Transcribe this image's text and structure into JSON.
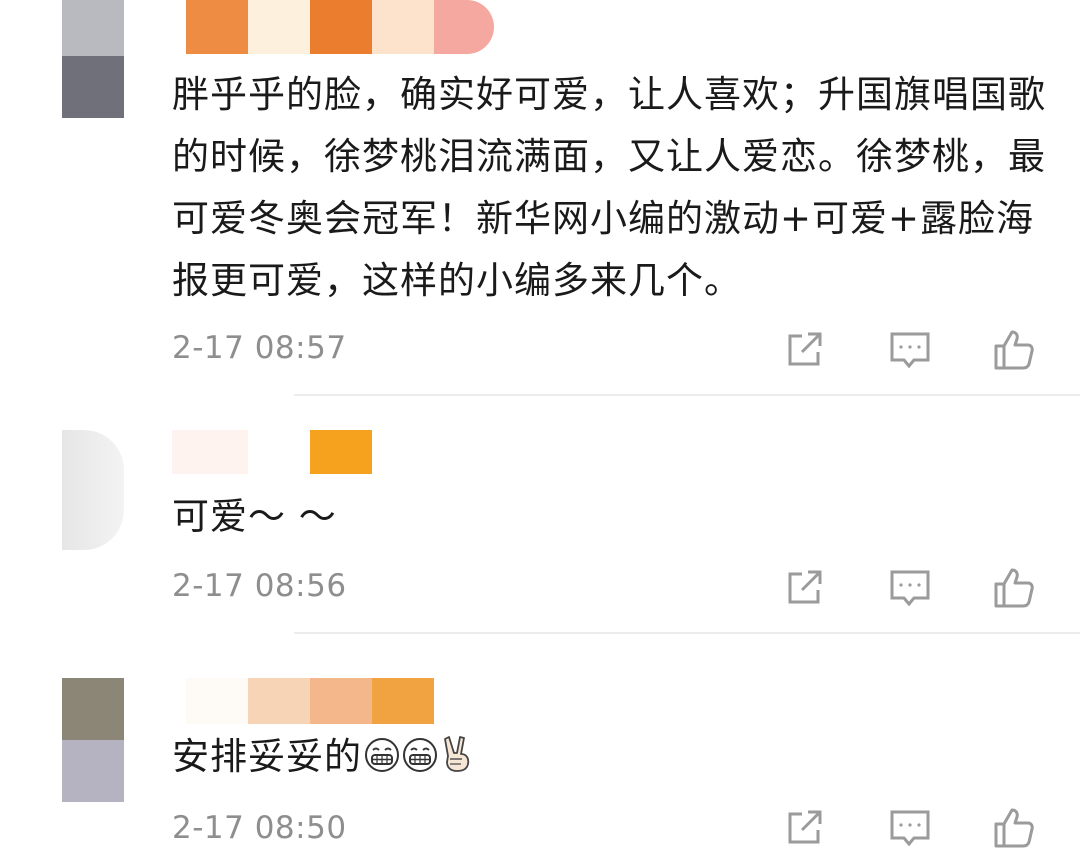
{
  "comments": [
    {
      "text": "胖乎乎的脸，确实好可爱，让人喜欢；升国旗唱国歌的时候，徐梦桃泪流满面，又让人爱恋。徐梦桃，最可爱冬奥会冠军！新华网小编的激动+可爱+露脸海报更可爱，这样的小编多来几个。",
      "time": "2-17 08:57",
      "avatar_colors": [
        "#b9b9c0",
        "#6f7079"
      ],
      "name_colors": [
        "#ef8c44",
        "#fdf0dd",
        "#eb7d2f",
        "#fde2cc",
        "#f4a8a0"
      ]
    },
    {
      "text": "可爱～ ～",
      "time": "2-17 08:56",
      "avatar_colors": [
        "#e8e8e8",
        "#dcdcdc"
      ],
      "name_colors": [
        "#fff3ef",
        "#ffffff",
        "#f6a21f"
      ]
    },
    {
      "text": "安排妥妥的",
      "time": "2-17 08:50",
      "avatar_colors": [
        "#8c8676",
        "#b5b3c2"
      ],
      "name_colors": [
        "#fefaf6",
        "#f7d4b5",
        "#f3b78b",
        "#f1a341"
      ]
    }
  ],
  "icons": {
    "share": "share-icon",
    "comment": "comment-icon",
    "like": "like-icon",
    "grin_emoji": "grin-emoji-icon",
    "victory_emoji": "victory-hand-emoji-icon"
  },
  "colors": {
    "icon": "#9b9b9b",
    "time": "#8e8e8e",
    "divider": "#ececec"
  }
}
